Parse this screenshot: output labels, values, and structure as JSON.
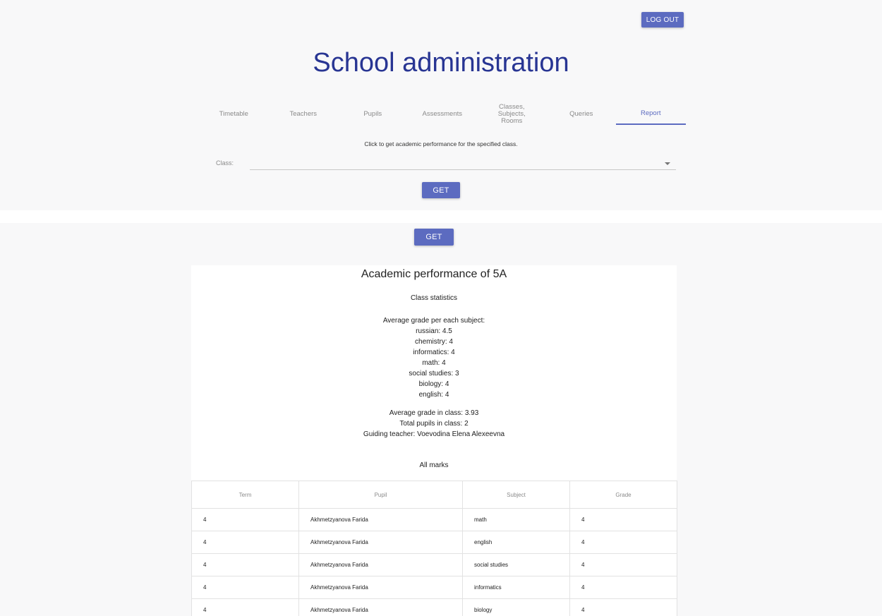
{
  "header": {
    "logout_label": "LOG OUT",
    "title": "School administration"
  },
  "tabs": [
    {
      "label": "Timetable"
    },
    {
      "label": "Teachers"
    },
    {
      "label": "Pupils"
    },
    {
      "label": "Assessments"
    },
    {
      "label": "Classes, Subjects, Rooms"
    },
    {
      "label": "Queries"
    },
    {
      "label": "Report",
      "active": true
    }
  ],
  "report_form": {
    "hint": "Click to get academic performance for the specified class.",
    "class_label": "Class:",
    "class_value": "",
    "get_label": "GET"
  },
  "report": {
    "get_label": "GET",
    "title": "Academic performance of 5A",
    "class_statistics_heading": "Class statistics",
    "avg_heading": "Average grade per each subject:",
    "subject_averages": [
      "russian: 4.5",
      "chemistry: 4",
      "informatics: 4",
      "math: 4",
      "social studies: 3",
      "biology: 4",
      "english: 4"
    ],
    "avg_class": "Average grade in class: 3.93",
    "total_pupils": "Total pupils in class: 2",
    "guiding_teacher": "Guiding teacher: Voevodina Elena Alexeevna",
    "marks_heading": "All marks",
    "columns": [
      "Term",
      "Pupil",
      "Subject",
      "Grade"
    ],
    "rows": [
      [
        "4",
        "Akhmetzyanova Farida",
        "math",
        "4"
      ],
      [
        "4",
        "Akhmetzyanova Farida",
        "english",
        "4"
      ],
      [
        "4",
        "Akhmetzyanova Farida",
        "social studies",
        "4"
      ],
      [
        "4",
        "Akhmetzyanova Farida",
        "informatics",
        "4"
      ],
      [
        "4",
        "Akhmetzyanova Farida",
        "biology",
        "4"
      ]
    ]
  },
  "colors": {
    "accent": "#5c6bc0",
    "title": "#283593",
    "panel_bg": "#f8f8f9"
  }
}
